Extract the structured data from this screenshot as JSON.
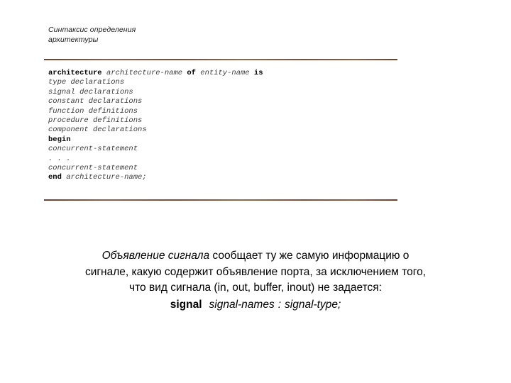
{
  "slide": {
    "title_lines": [
      "Синтаксис определения",
      "архитектуры"
    ],
    "rule_color": "#7a4b3c"
  },
  "code_block": {
    "lines": [
      {
        "segments": [
          {
            "text": "architecture",
            "style": "keyword"
          },
          {
            "text": " ",
            "style": "plain"
          },
          {
            "text": "architecture-name",
            "style": "placeholder"
          },
          {
            "text": " ",
            "style": "plain"
          },
          {
            "text": "of",
            "style": "keyword"
          },
          {
            "text": " ",
            "style": "plain"
          },
          {
            "text": "entity-name",
            "style": "placeholder"
          },
          {
            "text": " ",
            "style": "plain"
          },
          {
            "text": "is",
            "style": "keyword"
          }
        ]
      },
      {
        "segments": [
          {
            "text": "type declarations",
            "style": "placeholder"
          }
        ]
      },
      {
        "segments": [
          {
            "text": "signal declarations",
            "style": "placeholder"
          }
        ]
      },
      {
        "segments": [
          {
            "text": "constant declarations",
            "style": "placeholder"
          }
        ]
      },
      {
        "segments": [
          {
            "text": "function definitions",
            "style": "placeholder"
          }
        ]
      },
      {
        "segments": [
          {
            "text": "procedure definitions",
            "style": "placeholder"
          }
        ]
      },
      {
        "segments": [
          {
            "text": "component declarations",
            "style": "placeholder"
          }
        ]
      },
      {
        "segments": [
          {
            "text": "begin",
            "style": "keyword"
          }
        ]
      },
      {
        "segments": [
          {
            "text": "concurrent-statement",
            "style": "placeholder"
          }
        ]
      },
      {
        "segments": [
          {
            "text": ". . .",
            "style": "placeholder"
          }
        ]
      },
      {
        "segments": [
          {
            "text": "concurrent-statement",
            "style": "placeholder"
          }
        ]
      },
      {
        "segments": [
          {
            "text": "end",
            "style": "keyword"
          },
          {
            "text": " ",
            "style": "plain"
          },
          {
            "text": "architecture-name;",
            "style": "placeholder"
          }
        ]
      }
    ]
  },
  "body": {
    "line1_italic": "Объявление сигнала",
    "line1_rest": " сообщает ту же самую информацию о",
    "line2": "сигнале, какую содержит объявление порта, за исключением того,",
    "line3": "что вид сигнала (in, out, buffer, inout) не задается:",
    "signal_keyword": "signal",
    "signal_names": "signal-names",
    "signal_colon": ":",
    "signal_type": "signal-type;"
  }
}
